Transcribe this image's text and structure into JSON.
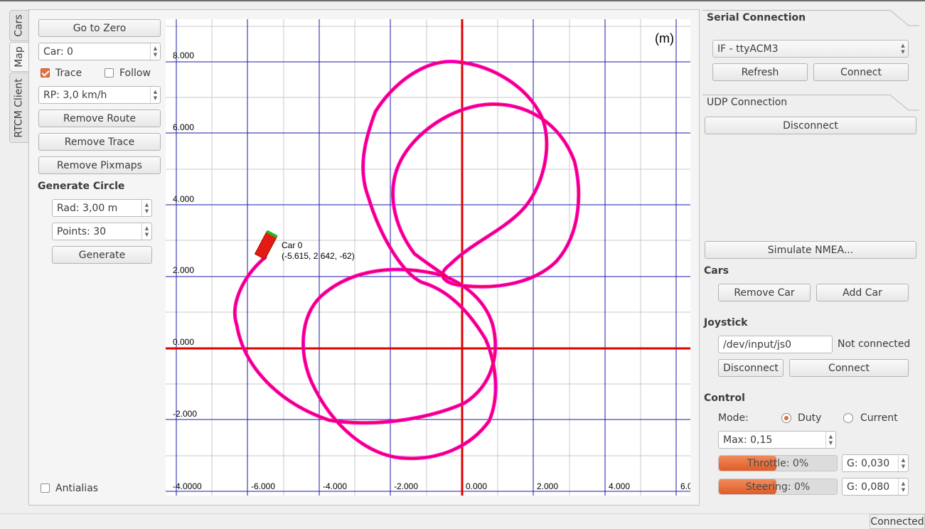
{
  "tabs": [
    {
      "label": "Cars"
    },
    {
      "label": "Map"
    },
    {
      "label": "RTCM Client"
    }
  ],
  "left_panel": {
    "go_to_zero": "Go to Zero",
    "car_select": "Car: 0",
    "trace_label": "Trace",
    "trace_checked": true,
    "follow_label": "Follow",
    "follow_checked": false,
    "rp_value": "RP: 3,0 km/h",
    "remove_route": "Remove Route",
    "remove_trace": "Remove Trace",
    "remove_pixmaps": "Remove Pixmaps",
    "generate_circle_title": "Generate Circle",
    "rad_value": "Rad: 3,00 m",
    "points_value": "Points: 30",
    "generate": "Generate",
    "antialias_label": "Antialias",
    "antialias_checked": false
  },
  "map": {
    "unit_label": "(m)",
    "y_ticks": [
      "8.000",
      "6.000",
      "4.000",
      "2.000",
      "0.000",
      "-2.000",
      "-4.0000"
    ],
    "x_ticks": [
      "-6.000",
      "-4.000",
      "-2.000",
      "0.000",
      "2.000",
      "4.000",
      "6.0"
    ],
    "car_label": "Car 0",
    "car_coords": "(-5.615, 2.642, -62)",
    "colors": {
      "grid": "#1a1aa8",
      "axis": "#e00000",
      "trace": "#ff00cc",
      "trace_inner": "#e8003a",
      "car": "#e31b12"
    }
  },
  "right_panel": {
    "serial_title": "Serial Connection",
    "serial_port": "IF - ttyACM3",
    "refresh": "Refresh",
    "connect": "Connect",
    "udp_title": "UDP Connection",
    "udp_disconnect": "Disconnect",
    "simulate_nmea": "Simulate NMEA...",
    "cars_title": "Cars",
    "remove_car": "Remove Car",
    "add_car": "Add Car",
    "joystick_title": "Joystick",
    "joystick_path": "/dev/input/js0",
    "joystick_status": "Not connected",
    "joy_disconnect": "Disconnect",
    "joy_connect": "Connect",
    "control_title": "Control",
    "mode_label": "Mode:",
    "mode_duty": "Duty",
    "mode_current": "Current",
    "mode_selected": "Duty",
    "max_value": "Max: 0,15",
    "throttle_text": "Throttle: 0%",
    "throttle_fill": 0.49,
    "throttle_g": "G: 0,030",
    "steering_text": "Steering: 0%",
    "steering_fill": 0.49,
    "steering_g": "G: 0,080"
  },
  "status_bar": {
    "status": "Connected"
  }
}
